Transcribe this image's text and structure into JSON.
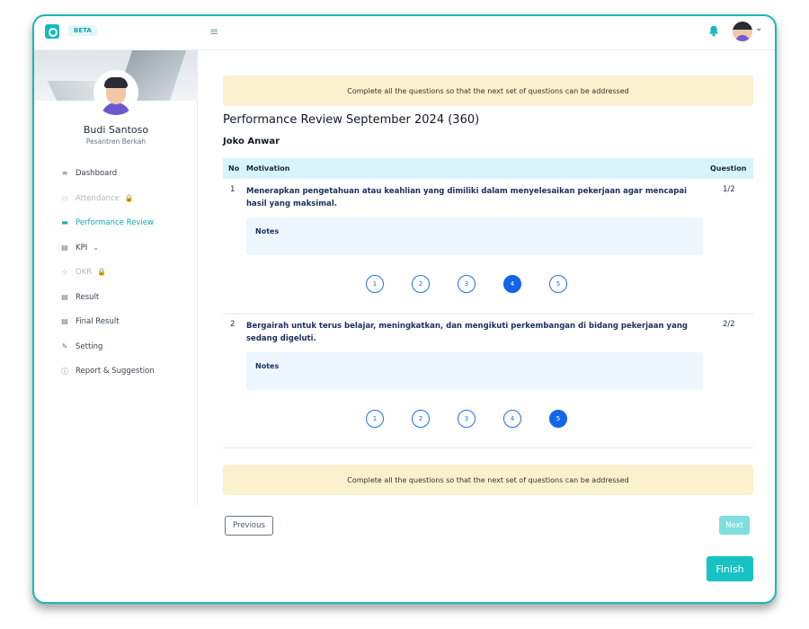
{
  "header": {
    "badge": "BETA",
    "menu_icon": "hamburger-icon",
    "notification_icon": "bell-icon"
  },
  "profile": {
    "name": "Budi Santoso",
    "org": "Pesantren Berkah"
  },
  "sidebar": {
    "items": [
      {
        "label": "Dashboard",
        "icon": "≡",
        "state": "normal"
      },
      {
        "label": "Attendance",
        "icon": "▭",
        "state": "disabled",
        "extra": "🔒"
      },
      {
        "label": "Performance Review",
        "icon": "▬",
        "state": "active"
      },
      {
        "label": "KPI",
        "icon": "▤",
        "state": "normal",
        "extra": "⌄"
      },
      {
        "label": "OKR",
        "icon": "⊹",
        "state": "disabled",
        "extra": "🔒"
      },
      {
        "label": "Result",
        "icon": "▤",
        "state": "normal"
      },
      {
        "label": "Final Result",
        "icon": "▤",
        "state": "normal"
      },
      {
        "label": "Setting",
        "icon": "✎",
        "state": "normal"
      },
      {
        "label": "Report & Suggestion",
        "icon": "ⓘ",
        "state": "normal"
      }
    ]
  },
  "main": {
    "banner_text": "Complete all the questions so that the next set of questions can be addressed",
    "title": "Performance Review September 2024 (360)",
    "subject": "Joko Anwar",
    "table": {
      "headers": [
        "No",
        "Motivation",
        "Question"
      ]
    },
    "questions": [
      {
        "no": "1",
        "text": "Menerapkan pengetahuan atau keahlian yang dimiliki dalam menyelesaikan pekerjaan agar mencapai hasil yang maksimal.",
        "progress": "1/2",
        "notes_label": "Notes",
        "options": [
          "1",
          "2",
          "3",
          "4",
          "5"
        ],
        "selected": "4"
      },
      {
        "no": "2",
        "text": "Bergairah untuk terus belajar, meningkatkan, dan mengikuti perkembangan di bidang pekerjaan yang sedang digeluti.",
        "progress": "2/2",
        "notes_label": "Notes",
        "options": [
          "1",
          "2",
          "3",
          "4",
          "5"
        ],
        "selected": "5"
      }
    ],
    "buttons": {
      "previous": "Previous",
      "next": "Next",
      "finish": "Finish"
    }
  },
  "colors": {
    "accent": "#17c2c2",
    "banner": "#fcf1cf",
    "table_header": "#d6f4fa",
    "rating_selected": "#1565e8"
  }
}
